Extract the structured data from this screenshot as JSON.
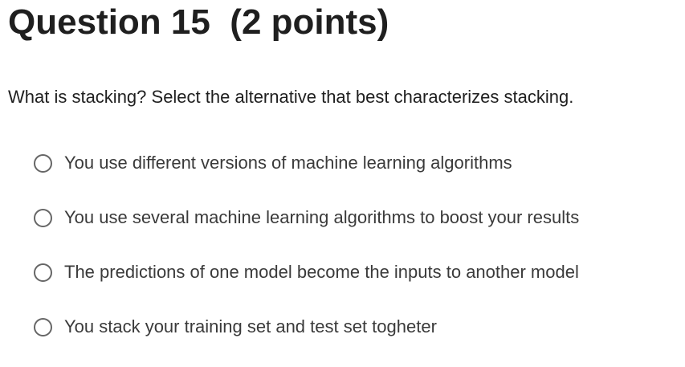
{
  "question": {
    "title": "Question 15  (2 points)",
    "prompt": "What is stacking? Select the alternative that best characterizes stacking.",
    "options": [
      {
        "label": "You use different versions of machine learning algorithms",
        "selected": false
      },
      {
        "label": "You use several machine learning algorithms to boost your results",
        "selected": false
      },
      {
        "label": "The predictions of one model become the inputs to another model",
        "selected": false
      },
      {
        "label": "You stack your training set and test set togheter",
        "selected": false
      }
    ]
  }
}
